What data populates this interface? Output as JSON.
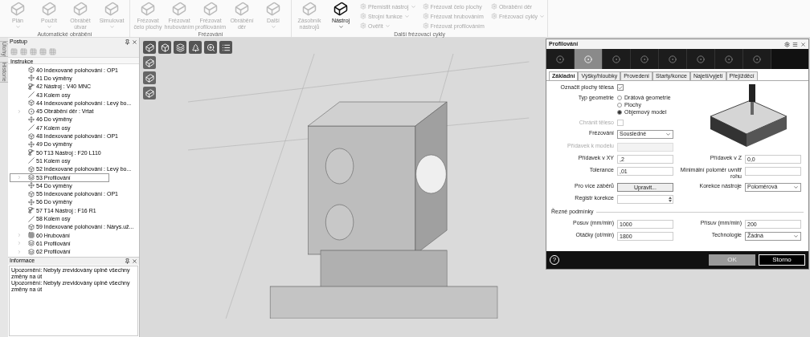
{
  "ribbon": {
    "groups": [
      {
        "title": "Automatické obrábění",
        "items": [
          {
            "label": "Plán",
            "disabled": true,
            "dropdown": true
          },
          {
            "label": "Použít",
            "disabled": true,
            "dropdown": true
          },
          {
            "label": "Obrábět útvar",
            "disabled": true,
            "dropdown": false
          },
          {
            "label": "Simulovat",
            "disabled": true,
            "dropdown": true
          }
        ]
      },
      {
        "title": "Frézování",
        "items": [
          {
            "label": "Frézovat čelo plochy",
            "disabled": true,
            "dropdown": false
          },
          {
            "label": "Frézovat hrubováním",
            "disabled": true,
            "dropdown": false
          },
          {
            "label": "Frézovat profilováním",
            "disabled": true,
            "dropdown": false
          },
          {
            "label": "Obrábění děr",
            "disabled": true,
            "dropdown": false
          },
          {
            "label": "Další",
            "disabled": true,
            "dropdown": true
          }
        ]
      },
      {
        "title": "Další frézovací cykly",
        "items": [
          {
            "label": "Zásobník nástrojů",
            "disabled": true,
            "dropdown": false
          },
          {
            "label": "Nástroj",
            "disabled": false,
            "dropdown": true
          }
        ],
        "small_items": [
          {
            "label": "Přemístit nástroj",
            "disabled": true,
            "dropdown": true
          },
          {
            "label": "Strojní funkce",
            "disabled": true,
            "dropdown": true
          },
          {
            "label": "Ověřit",
            "disabled": true,
            "dropdown": true
          },
          {
            "label": "Frézovat čelo plochy",
            "disabled": true,
            "dropdown": false
          },
          {
            "label": "Frézovat hrubováním",
            "disabled": true,
            "dropdown": false
          },
          {
            "label": "Frézovat profilováním",
            "disabled": true,
            "dropdown": false
          },
          {
            "label": "Obrábění děr",
            "disabled": true,
            "dropdown": false
          },
          {
            "label": "Frézovací cykly",
            "disabled": true,
            "dropdown": true
          }
        ]
      }
    ]
  },
  "side_tabs": [
    "Úlohy",
    "Historie"
  ],
  "postup": {
    "title": "Postup",
    "list_header": "Instrukce",
    "items": [
      {
        "text": "40 Indexované polohování : OP1",
        "kind": "index",
        "expandable": false,
        "selected": false
      },
      {
        "text": "41 Do výměny",
        "kind": "change",
        "expandable": false,
        "selected": false
      },
      {
        "text": "42 Nástroj : V40 MNC",
        "kind": "tool",
        "expandable": false,
        "selected": false
      },
      {
        "text": "43 Kolem osy",
        "kind": "axis",
        "expandable": false,
        "selected": false
      },
      {
        "text": "44 Indexované polohování : Levý bo...",
        "kind": "index",
        "expandable": false,
        "selected": false
      },
      {
        "text": "45 Obrábění děr : Vrtat",
        "kind": "holes",
        "expandable": true,
        "selected": false
      },
      {
        "text": "46 Do výměny",
        "kind": "change",
        "expandable": false,
        "selected": false
      },
      {
        "text": "47 Kolem osy",
        "kind": "axis",
        "expandable": false,
        "selected": false
      },
      {
        "text": "48 Indexované polohování : OP1",
        "kind": "index",
        "expandable": false,
        "selected": false
      },
      {
        "text": "49 Do výměny",
        "kind": "change",
        "expandable": false,
        "selected": false
      },
      {
        "text": "50 T13 Nástroj : F20 L110",
        "kind": "tool",
        "expandable": false,
        "selected": false
      },
      {
        "text": "51 Kolem osy",
        "kind": "axis",
        "expandable": false,
        "selected": false
      },
      {
        "text": "52 Indexované polohování : Levý bo...",
        "kind": "index",
        "expandable": false,
        "selected": false
      },
      {
        "text": "53 Profilování",
        "kind": "profile",
        "expandable": true,
        "selected": true
      },
      {
        "text": "54 Do výměny",
        "kind": "change",
        "expandable": false,
        "selected": false
      },
      {
        "text": "55 Indexované polohování : OP1",
        "kind": "index",
        "expandable": false,
        "selected": false
      },
      {
        "text": "56 Do výměny",
        "kind": "change",
        "expandable": false,
        "selected": false
      },
      {
        "text": "57 T14 Nástroj : F16 R1",
        "kind": "tool",
        "expandable": false,
        "selected": false
      },
      {
        "text": "58 Kolem osy",
        "kind": "axis",
        "expandable": false,
        "selected": false
      },
      {
        "text": "59 Indexované polohování : Nárys.už...",
        "kind": "index",
        "expandable": false,
        "selected": false
      },
      {
        "text": "60 Hrubování",
        "kind": "rough",
        "expandable": true,
        "selected": false
      },
      {
        "text": "61 Profilování",
        "kind": "profile",
        "expandable": true,
        "selected": false
      },
      {
        "text": "62 Profilování",
        "kind": "profile",
        "expandable": true,
        "selected": false
      }
    ]
  },
  "informace": {
    "title": "Informace",
    "messages": [
      "Upozornění: Nebyly zrevidovány úplně všechny změny na út",
      "Upozornění: Nebyly zrevidovány úplně všechny změny na út"
    ]
  },
  "dialog": {
    "title": "Profilování",
    "step_tabs": [
      {
        "selected": false
      },
      {
        "selected": true
      },
      {
        "selected": false
      },
      {
        "selected": false
      },
      {
        "selected": false
      },
      {
        "selected": false
      },
      {
        "selected": false
      },
      {
        "selected": false
      }
    ],
    "tabs": [
      {
        "label": "Základní",
        "selected": true
      },
      {
        "label": "Výšky/hloubky",
        "selected": false
      },
      {
        "label": "Provedení",
        "selected": false
      },
      {
        "label": "Starty/konce",
        "selected": false
      },
      {
        "label": "Najetí/vyjetí",
        "selected": false
      },
      {
        "label": "Přejížděcí",
        "selected": false
      }
    ],
    "top_fields": [
      {
        "label": "Označit plochy tělesa",
        "kind": "checkbox",
        "checked": true,
        "disabled": false
      },
      {
        "label": "Typ geometrie",
        "kind": "radio",
        "disabled": false,
        "options": [
          {
            "label": "Drátová geometrie",
            "selected": false
          },
          {
            "label": "Plochy",
            "selected": false
          },
          {
            "label": "Objemový model",
            "selected": true
          }
        ]
      },
      {
        "label": "Chránit těleso",
        "kind": "checkbox",
        "checked": false,
        "disabled": true
      },
      {
        "label": "Frézování",
        "kind": "select",
        "value": "Sousledné",
        "disabled": false
      },
      {
        "label": "Přídavek k modelu",
        "kind": "text",
        "disabled": true
      }
    ],
    "pairs": [
      [
        {
          "label": "Přídavek v XY",
          "kind": "text",
          "value": ",2",
          "disabled": false
        },
        {
          "label": "Přídavek v Z",
          "kind": "text",
          "value": "0,0",
          "disabled": false
        }
      ],
      [
        {
          "label": "Tolerance",
          "kind": "text",
          "value": ",01",
          "disabled": false
        },
        {
          "label": "Minimální poloměr uvnitř rohu",
          "kind": "text",
          "disabled": false
        }
      ],
      [
        {
          "label": "Pro více záběrů",
          "kind": "button",
          "value": "Upravit...",
          "disabled": false
        },
        {
          "label": "Korekce nástroje",
          "kind": "select",
          "value": "Poloměrová",
          "disabled": false
        }
      ],
      [
        {
          "label": "Registr korekce",
          "kind": "spinner",
          "disabled": false
        }
      ]
    ],
    "section": {
      "title": "Řezné podmínky",
      "pairs": [
        [
          {
            "label": "Posuv (mm/min)",
            "kind": "text",
            "value": "1000",
            "disabled": false
          },
          {
            "label": "Přísuv (mm/min)",
            "kind": "text",
            "value": "200",
            "disabled": false
          }
        ],
        [
          {
            "label": "Otáčky (ot/min)",
            "kind": "text",
            "value": "1800",
            "disabled": false
          },
          {
            "label": "Technologie",
            "kind": "select",
            "value": "Žádná",
            "disabled": false
          }
        ]
      ]
    },
    "help": "?",
    "buttons": [
      {
        "label": "OK",
        "kind": "primary"
      },
      {
        "label": "Storno",
        "kind": "secondary"
      }
    ]
  }
}
